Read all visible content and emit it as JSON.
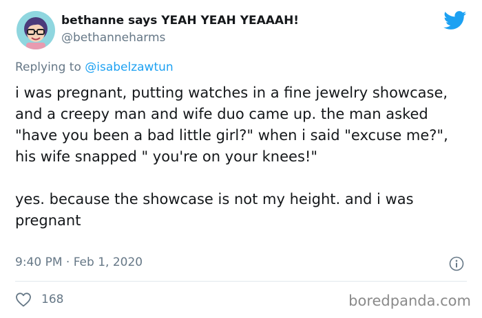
{
  "tweet": {
    "display_name": "bethanne says YEAH YEAH YEAAAH!",
    "handle": "@bethanneharms",
    "reply_prefix": "Replying to",
    "reply_to": "@isabelzawtun",
    "paragraphs": [
      "i was pregnant, putting watches in a fine jewelry showcase, and a creepy man and wife duo came up. the man asked \"have you been a bad little girl?\" when i said \"excuse me?\", his wife snapped \" you're on your knees!\"",
      "yes. because the showcase is not my height. and i was pregnant"
    ],
    "timestamp": "9:40 PM · Feb 1, 2020",
    "like_count": "168"
  },
  "watermark": "boredpanda.com",
  "icons": {
    "avatar": "cartoon-avatar-with-glasses",
    "brand": "twitter-bird-icon",
    "info": "info-icon",
    "like": "heart-icon"
  },
  "colors": {
    "brand_blue": "#1da1f2",
    "secondary_text": "#657786",
    "primary_text": "#14171a"
  }
}
